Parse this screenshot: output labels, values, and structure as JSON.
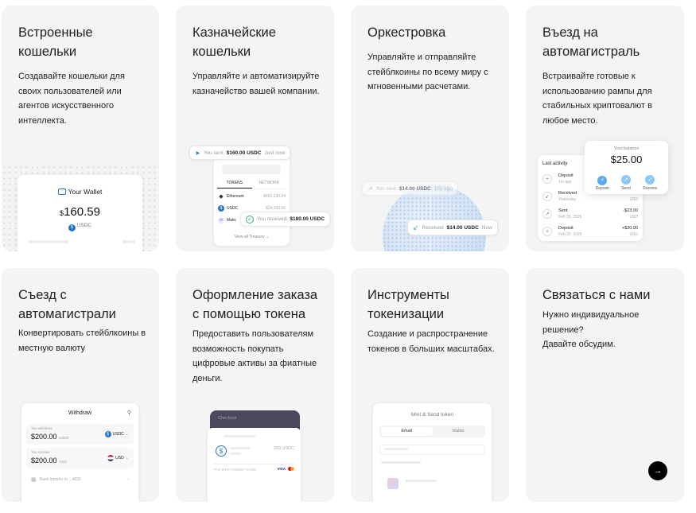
{
  "cards": [
    {
      "title": "Встроенные\nкошельки",
      "desc": "Создавайте кошельки для\nсвоих пользователей или\nагентов искусственного\nинтеллекта.",
      "wallet": {
        "label": "Your Wallet",
        "currency_symbol": "$",
        "amount": "160.59",
        "token": "USDC"
      }
    },
    {
      "title": "Казначейские\nкошельки",
      "desc": "Управляйте и автоматизируйте\nказначейство вашей компании.",
      "sent_toast": {
        "prefix": "You sent",
        "amount": "$160.00 USDC",
        "time": "Just now"
      },
      "tabs": [
        "TOKENS",
        "NETWORK"
      ],
      "tokens": [
        {
          "name": "Ethereum",
          "value": "$462,230.04"
        },
        {
          "name": "USDC",
          "value": "$24,330.50"
        },
        {
          "name": "Matic",
          "value": ""
        }
      ],
      "received_toast": {
        "prefix": "You received",
        "amount": "$180.00 USDC"
      },
      "view_all": "View all Treasury"
    },
    {
      "title": "Оркестровка",
      "desc": "Управляйте и отправляйте\nстейблкоины по всему миру с\nмгновенными расчетами.",
      "sent_toast": {
        "prefix": "You sent",
        "amount": "$14.00 USDC",
        "time": "15s ago"
      },
      "received_toast": {
        "prefix": "Received",
        "amount": "$14.00 USDC",
        "time": "Now"
      }
    },
    {
      "title": "Въезд на\nавтомагистраль",
      "desc": "Встраивайте готовые к\nиспользованию рампы для\nстабильных криптовалют в\nлюбое место.",
      "balance": {
        "label": "Your balance",
        "amount": "$25.00",
        "actions": [
          "Deposit",
          "Send",
          "Receive"
        ]
      },
      "activity": {
        "title": "Last activity",
        "items": [
          {
            "name": "Deposit",
            "time": "1m ago",
            "amount": "",
            "cur": ""
          },
          {
            "name": "Received",
            "time": "Yesterday",
            "amount": "",
            "cur": "USD"
          },
          {
            "name": "Sent",
            "time": "Feb 20, 2025",
            "amount": "-$23.00",
            "cur": "USD"
          },
          {
            "name": "Deposit",
            "time": "Feb 20, 2025",
            "amount": "+$20.00",
            "cur": "USD"
          }
        ]
      }
    },
    {
      "title": "Съезд с\nавтомагистрали",
      "desc": "Конвертировать стейблкоины в\nместную валюту",
      "withdraw": {
        "title": "Withdraw",
        "rows": [
          {
            "label": "You withdraw",
            "amount": "$200.00",
            "unit": "USDC",
            "currency": "USDC"
          },
          {
            "label": "You receive",
            "amount": "$200.00",
            "unit": "USD",
            "currency": "USD"
          }
        ],
        "bank": "Bank transfer to ...4839"
      }
    },
    {
      "title": "Оформление заказа\nс помощью токена",
      "desc": "Предоставить пользователям\nвозможность покупать\nцифровые активы за фиатные\nденьги.",
      "checkout": {
        "header": "Checkout",
        "amount": "200 USDC",
        "pay_with": "PAY WITH CREDIT CARD",
        "brands": [
          "VISA",
          "MC"
        ]
      }
    },
    {
      "title": "Инструменты\nтокенизации",
      "desc": "Создание и распространение\nтокенов в больших масштабах.",
      "mint": {
        "title": "Mint & Send token",
        "tabs": [
          "Email",
          "Wallet"
        ]
      }
    },
    {
      "title": "Связаться с нами",
      "desc": "Нужно индивидуальное\nрешение?\nДавайте обсудим.",
      "cta_icon": "arrow-right-icon"
    }
  ],
  "colors": {
    "card_bg": "#f4f4f5",
    "accent_blue": "#2775ca",
    "dark_button": "#000000",
    "green": "#3cb371"
  }
}
